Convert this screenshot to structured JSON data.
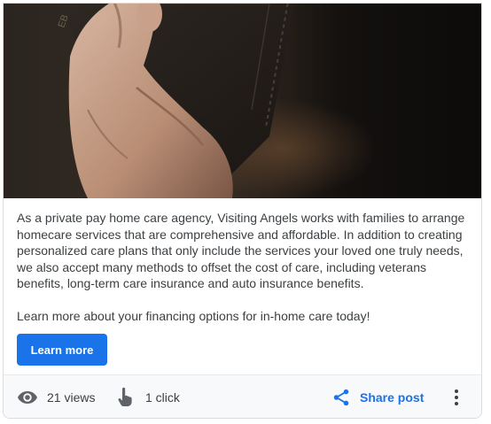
{
  "post": {
    "image_alt_icon": "wallet-photo",
    "paragraphs": [
      "As a private pay home care agency, Visiting Angels works with families to arrange homecare services that are comprehensive and affordable. In addition to creating personalized care plans that only include the services your loved one truly needs, we also accept many methods to offset the cost of care, including veterans benefits, long-term care insurance and auto insurance benefits.",
      "Learn more about your financing options for in-home care today!"
    ],
    "cta_label": "Learn more"
  },
  "footer": {
    "views_icon": "eye-icon",
    "views_label": "21 views",
    "clicks_icon": "pointer-hand-icon",
    "clicks_label": "1 click",
    "share_icon": "share-icon",
    "share_label": "Share post",
    "more_icon": "more-vert-icon"
  },
  "colors": {
    "accent": "#1a73e8",
    "text": "#3c4043",
    "icon": "#5f6368",
    "footer_bg": "#f8f9fa"
  }
}
